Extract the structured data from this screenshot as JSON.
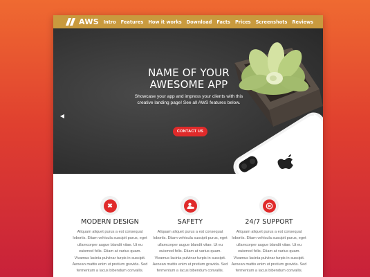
{
  "logo": {
    "text": "AWS"
  },
  "nav": [
    "Intro",
    "Features",
    "How it works",
    "Download",
    "Facts",
    "Prices",
    "Screenshots",
    "Reviews"
  ],
  "hero": {
    "title": "NAME OF YOUR AWESOME APP",
    "subtitle": "Showcase your app and impress your clients with this creative landing page! See all AWS features below.",
    "cta": "CONTACT US",
    "slides": 3,
    "active_slide": 3,
    "prev_icon": "chevron-left-icon",
    "next_icon": "chevron-right-icon"
  },
  "features": [
    {
      "icon": "cross-circle-icon",
      "title": "MODERN DESIGN",
      "text": "Aliquam aliquet purus a est consequat lobortis. Etiam vehicula suscipit purus, eget ullamcorper augue blandit vitae. Ut eu euismod felis. Etiam at varius quam. Vivamus lacinia pulvinar turpis in suscipit. Aenean mattis enim ut pretium gravida. Sed fermentum a lacus bibendum convallis."
    },
    {
      "icon": "user-lock-icon",
      "title": "SAFETY",
      "text": "Aliquam aliquet purus a est consequat lobortis. Etiam vehicula suscipit purus, eget ullamcorper augue blandit vitae. Ut eu euismod felis. Etiam at varius quam. Vivamus lacinia pulvinar turpis in suscipit. Aenean mattis enim ut pretium gravida. Sed fermentum a lacus bibendum convallis."
    },
    {
      "icon": "close-circle-icon",
      "title": "24/7 SUPPORT",
      "text": "Aliquam aliquet purus a est consequat lobortis. Etiam vehicula suscipit purus, eget ullamcorper augue blandit vitae. Ut eu euismod felis. Etiam at varius quam. Vivamus lacinia pulvinar turpis in suscipit. Aenean mattis enim ut pretium gravida. Sed fermentum a lacus bibendum convallis."
    }
  ],
  "colors": {
    "navbar": "#c99a3e",
    "accent": "#e02a2a",
    "background_top": "#ef6a31",
    "background_bottom": "#c8213a"
  }
}
